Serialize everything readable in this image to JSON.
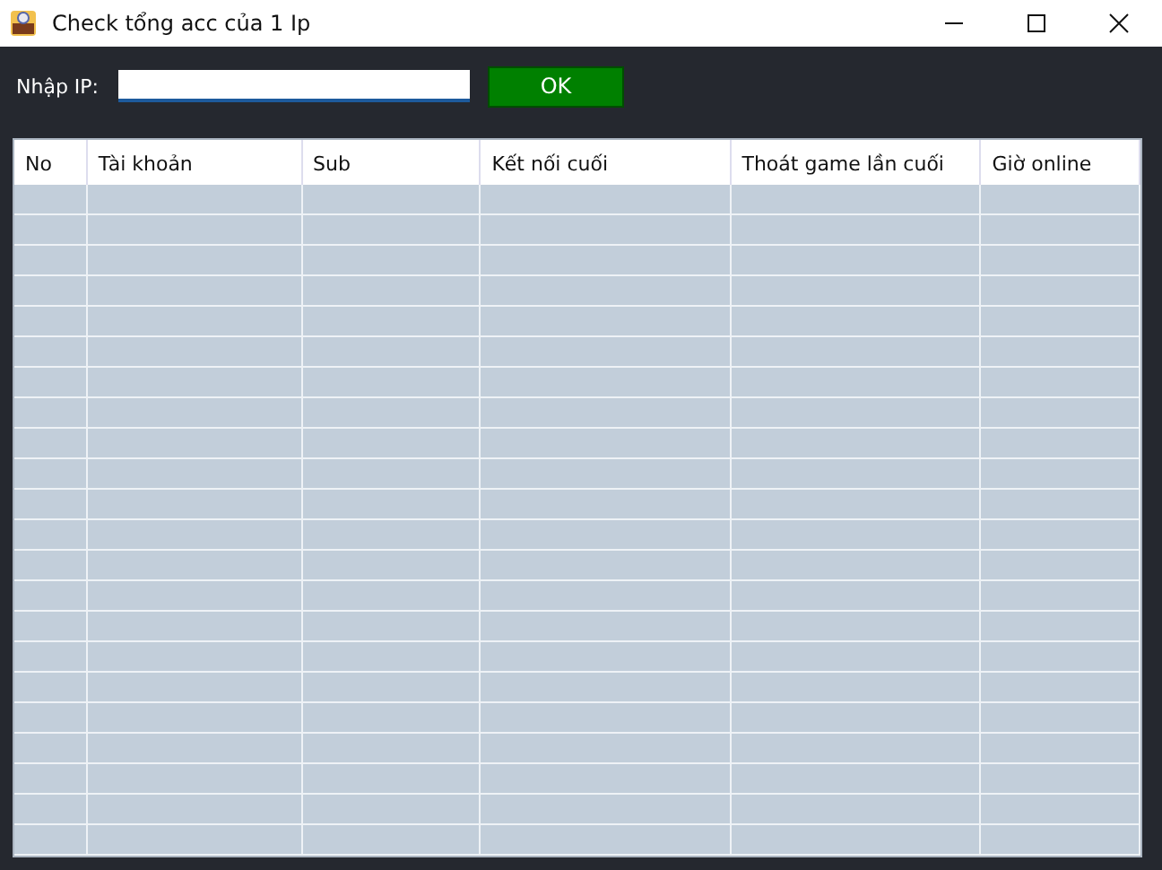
{
  "window": {
    "title": "Check tổng acc của 1 Ip"
  },
  "toolbar": {
    "ip_label": "Nhập IP:",
    "ok_button": "OK"
  },
  "table": {
    "columns": [
      "No",
      "Tài khoản",
      "Sub",
      "Kết nối cuối",
      "Thoát game lần cuối",
      "Giờ online"
    ]
  }
}
